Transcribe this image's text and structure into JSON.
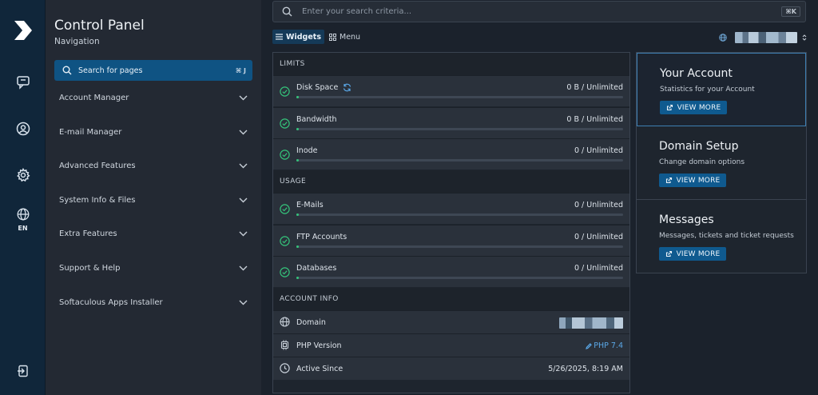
{
  "rail": {
    "language_code": "EN"
  },
  "nav": {
    "title": "Control Panel",
    "subtitle": "Navigation",
    "search_label": "Search for pages",
    "search_shortcut": "⌘ J",
    "items": [
      {
        "label": "Account Manager"
      },
      {
        "label": "E-mail Manager"
      },
      {
        "label": "Advanced Features"
      },
      {
        "label": "System Info & Files"
      },
      {
        "label": "Extra Features"
      },
      {
        "label": "Support & Help"
      },
      {
        "label": "Softaculous Apps Installer"
      }
    ]
  },
  "topbar": {
    "search_placeholder": "Enter your search criteria...",
    "search_shortcut": "⌘K",
    "view_widgets": "Widgets",
    "view_menu": "Menu"
  },
  "limits": {
    "heading": "LIMITS",
    "rows": [
      {
        "name": "Disk Space",
        "value": "0 B / Unlimited",
        "usage": 0
      },
      {
        "name": "Bandwidth",
        "value": "0 B / Unlimited",
        "usage": 0
      },
      {
        "name": "Inode",
        "value": "0 / Unlimited",
        "usage": 0
      }
    ]
  },
  "usage": {
    "heading": "USAGE",
    "rows": [
      {
        "name": "E-Mails",
        "value": "0 / Unlimited",
        "usage": 0
      },
      {
        "name": "FTP Accounts",
        "value": "0 / Unlimited",
        "usage": 0
      },
      {
        "name": "Databases",
        "value": "0 / Unlimited",
        "usage": 0
      }
    ]
  },
  "account_info": {
    "heading": "ACCOUNT INFO",
    "domain_label": "Domain",
    "php_label": "PHP Version",
    "php_value": "PHP 7.4",
    "active_label": "Active Since",
    "active_value": "5/26/2025, 8:19 AM"
  },
  "cards": [
    {
      "title": "Your Account",
      "desc": "Statistics for your Account",
      "button": "VIEW MORE"
    },
    {
      "title": "Domain Setup",
      "desc": "Change domain options",
      "button": "VIEW MORE"
    },
    {
      "title": "Messages",
      "desc": "Messages, tickets and ticket requests",
      "button": "VIEW MORE"
    }
  ],
  "colors": {
    "accent": "#0f5383",
    "success": "#35c27a",
    "link": "#5aa7e6",
    "rail": "#10263a"
  }
}
